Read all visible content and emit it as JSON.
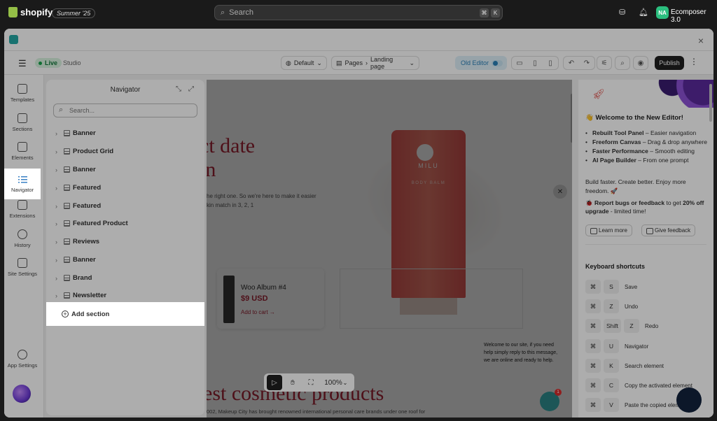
{
  "shopify": {
    "logo_text": "shopify",
    "edition": "Summer '25",
    "search_placeholder": "Search",
    "kbd_cmd": "⌘",
    "kbd_k": "K",
    "avatar_initials": "NA",
    "store_name": "Ecomposer 3.0"
  },
  "window": {
    "close": "×"
  },
  "toolbar": {
    "live_label": "Live",
    "studio_label": "Studio",
    "layout_select": "Default",
    "pages_label": "Pages",
    "page_select": "Landing page",
    "old_editor_label": "Old Editor",
    "publish_label": "Publish"
  },
  "rail": {
    "items": [
      {
        "label": "Templates"
      },
      {
        "label": "Sections"
      },
      {
        "label": "Elements"
      },
      {
        "label": "Navigator"
      },
      {
        "label": "Extensions"
      },
      {
        "label": "History"
      },
      {
        "label": "Site Settings"
      }
    ],
    "app_settings": "App Settings"
  },
  "navigator": {
    "title": "Navigator",
    "search_placeholder": "Search...",
    "sections": [
      {
        "label": "Banner"
      },
      {
        "label": "Product Grid"
      },
      {
        "label": "Banner"
      },
      {
        "label": "Featured"
      },
      {
        "label": "Featured"
      },
      {
        "label": "Featured Product"
      },
      {
        "label": "Reviews"
      },
      {
        "label": "Banner"
      },
      {
        "label": "Brand"
      },
      {
        "label": "Newsletter"
      }
    ],
    "add_section": "Add section"
  },
  "canvas": {
    "hero_line1": "ct date",
    "hero_line2": "in",
    "hero_text_line1": "he right one. So we're here to make it easier",
    "hero_text_line2": "kin match in 3, 2, 1",
    "tube_brand": "MILU",
    "tube_name": "BODY BALM",
    "product_title": "Woo Album #4",
    "product_price": "$9 USD",
    "add_to_cart": "Add to cart →",
    "chat_message": "Welcome to our site, if you need help simply reply to this message, we are online and ready to help.",
    "bottom_title": "est cosmetic products",
    "bottom_text": "002, Makeup City has brought renowned international personal care brands under one roof for",
    "zoom": "100%",
    "chat_badge": "1"
  },
  "right_panel": {
    "heading": "👋 Welcome to the New Editor!",
    "features": [
      {
        "bold": "Rebuilt Tool Panel",
        "text": " – Easier navigation"
      },
      {
        "bold": "Freeform Canvas",
        "text": " – Drag & drop anywhere"
      },
      {
        "bold": "Faster Performance",
        "text": " – Smooth editing"
      },
      {
        "bold": "AI Page Builder",
        "text": " – From one prompt"
      }
    ],
    "tagline": "Build faster. Create better. Enjoy more freedom. 🚀",
    "report_prefix": "🐞 ",
    "report_bold": "Report bugs or feedback",
    "report_mid": " to get ",
    "report_bold2": "20% off upgrade",
    "report_suffix": " - limited time!",
    "learn_more": "Learn more",
    "give_feedback": "Give feedback",
    "shortcuts_title": "Keyboard shortcuts",
    "shortcuts": [
      {
        "keys": [
          "⌘",
          "S"
        ],
        "desc": "Save"
      },
      {
        "keys": [
          "⌘",
          "Z"
        ],
        "desc": "Undo"
      },
      {
        "keys": [
          "⌘",
          "Shift",
          "Z"
        ],
        "desc": "Redo"
      },
      {
        "keys": [
          "⌘",
          "U"
        ],
        "desc": "Navigator"
      },
      {
        "keys": [
          "⌘",
          "K"
        ],
        "desc": "Search element"
      },
      {
        "keys": [
          "⌘",
          "C"
        ],
        "desc": "Copy the activated element"
      },
      {
        "keys": [
          "⌘",
          "V"
        ],
        "desc": "Paste the copied element"
      }
    ]
  }
}
